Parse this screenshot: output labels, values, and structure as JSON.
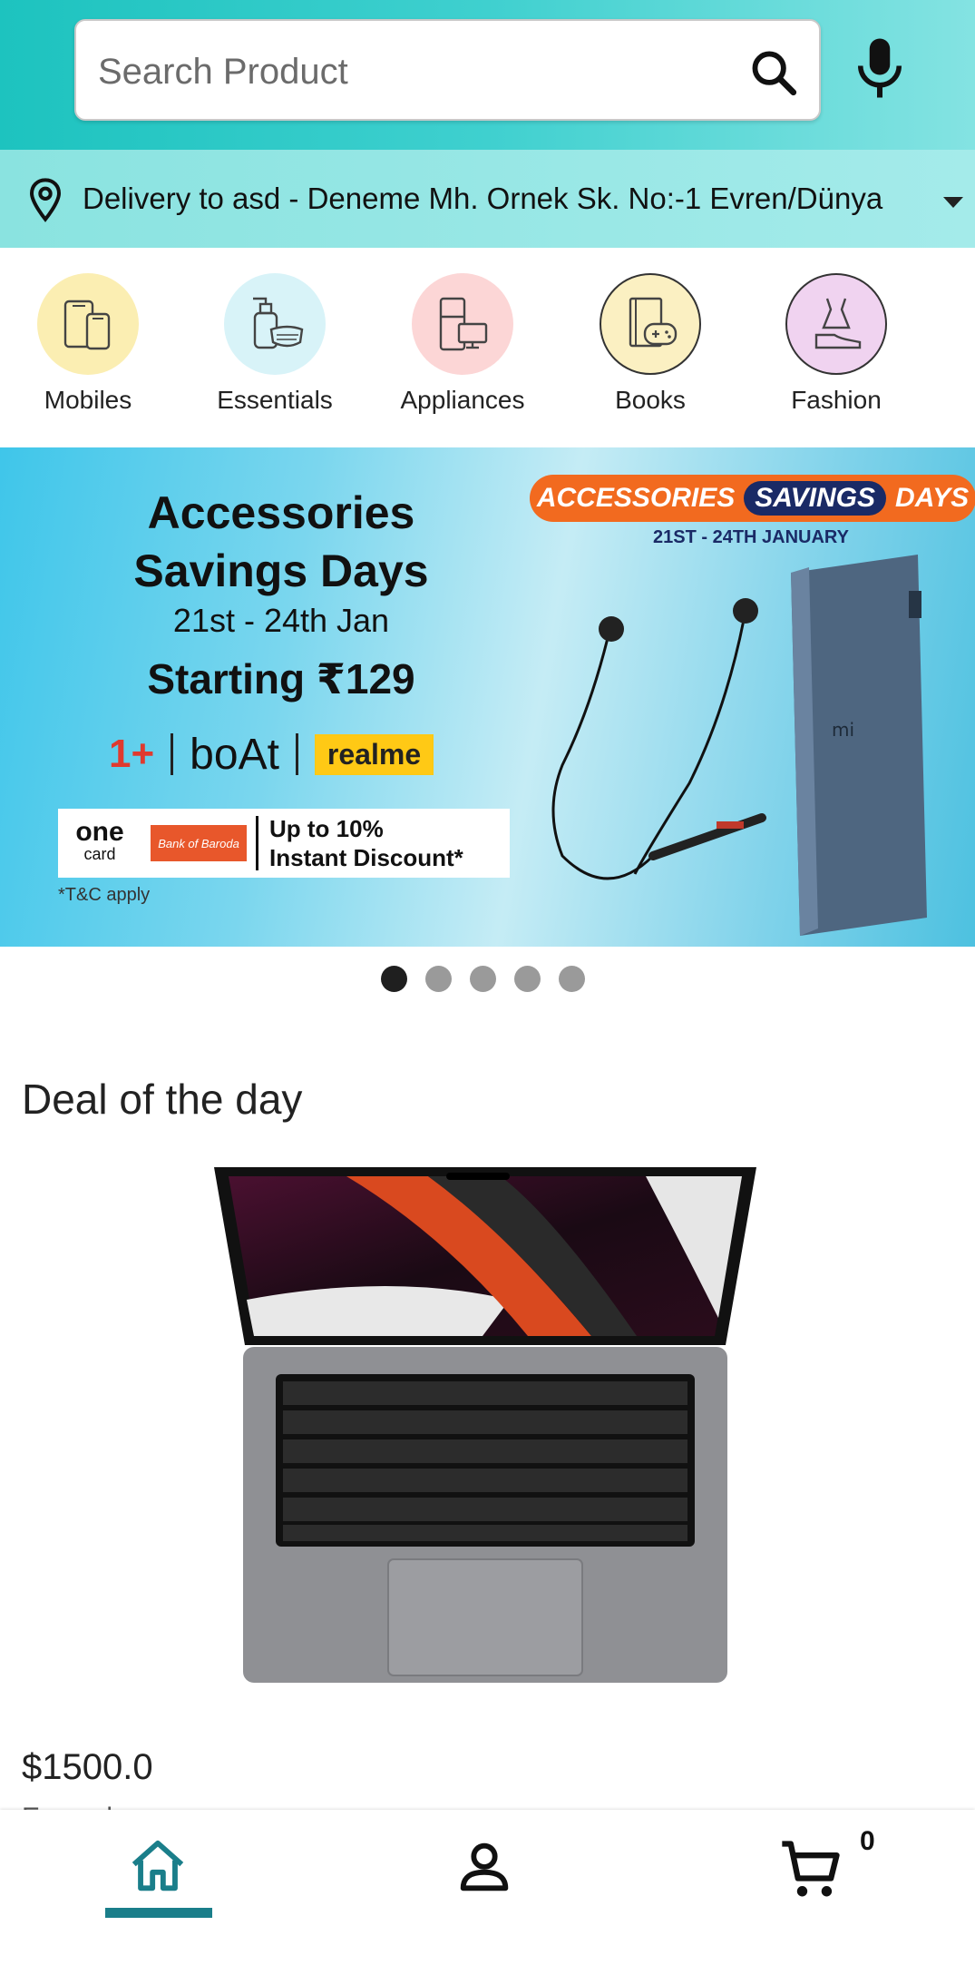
{
  "search": {
    "placeholder": "Search Product"
  },
  "delivery": {
    "text": "Delivery to asd - Deneme Mh. Ornek Sk. No:-1 Evren/Dünya"
  },
  "categories": [
    {
      "label": "Mobiles",
      "color": "#fbeeb2"
    },
    {
      "label": "Essentials",
      "color": "#d8f3f8"
    },
    {
      "label": "Appliances",
      "color": "#fcd6d6"
    },
    {
      "label": "Books",
      "color": "#fbf0c2"
    },
    {
      "label": "Fashion",
      "color": "#f0d3f0"
    }
  ],
  "banner": {
    "title_line1": "Accessories",
    "title_line2": "Savings Days",
    "date": "21st - 24th Jan",
    "price": "Starting ₹129",
    "brand1": "1+",
    "brand2": "boAt",
    "brand3": "realme",
    "card_brand": "one",
    "card_sub": "card",
    "bank": "Bank of Baroda",
    "discount_line1": "Up to 10%",
    "discount_line2": "Instant Discount*",
    "tc": "*T&C apply",
    "pill_left": "ACCESSORIES",
    "pill_mid": "SAVINGS",
    "pill_right": "DAYS",
    "sub_date": "21ST - 24TH JANUARY",
    "powerbank_logo": "mi"
  },
  "carousel": {
    "count": 5,
    "active_index": 0
  },
  "deal": {
    "title": "Deal of the day",
    "price": "$1500.0",
    "name": "Example"
  },
  "nav": {
    "accent": "#1a7e8a",
    "cart_count": "0"
  }
}
